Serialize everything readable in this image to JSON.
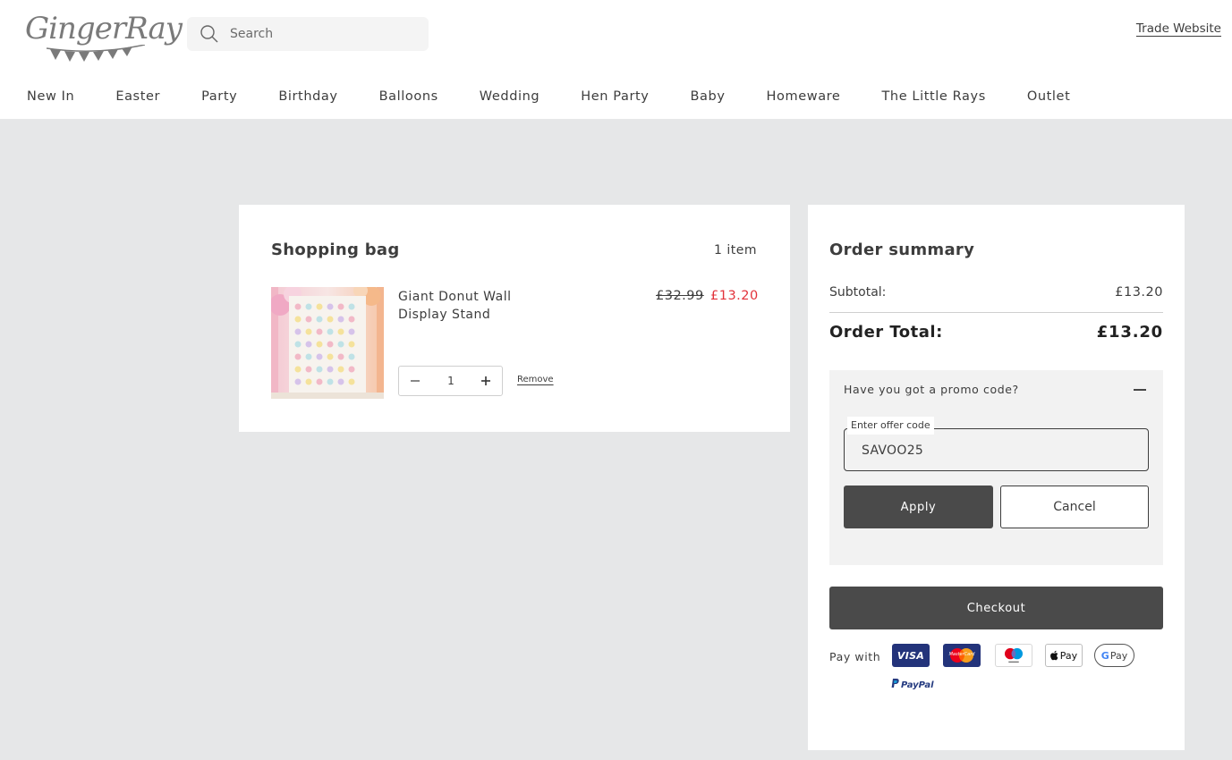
{
  "header": {
    "logo_text": "GingerRay",
    "search_placeholder": "Search",
    "trade_link": "Trade Website"
  },
  "nav": {
    "items": [
      "New In",
      "Easter",
      "Party",
      "Birthday",
      "Balloons",
      "Wedding",
      "Hen Party",
      "Baby",
      "Homeware",
      "The Little Rays",
      "Outlet"
    ]
  },
  "bag": {
    "title": "Shopping bag",
    "item_count": "1 item",
    "items": [
      {
        "name": "Giant Donut Wall Display Stand",
        "price_original": "£32.99",
        "price_sale": "£13.20",
        "quantity": "1",
        "remove_label": "Remove"
      }
    ]
  },
  "summary": {
    "title": "Order summary",
    "subtotal_label": "Subtotal:",
    "subtotal_value": "£13.20",
    "total_label": "Order Total:",
    "total_value": "£13.20",
    "promo": {
      "question": "Have you got a promo code?",
      "field_label": "Enter offer code",
      "field_value": "SAVOO25",
      "apply_label": "Apply",
      "cancel_label": "Cancel"
    },
    "checkout_label": "Checkout",
    "pay_with_label": "Pay with",
    "payment_methods": {
      "visa": "VISA",
      "mastercard": "MasterCard",
      "apple_pay": "Pay",
      "google_pay": "Pay",
      "google_g": "G",
      "paypal": "PayPal"
    }
  },
  "colors": {
    "page_bg": "#e6e7e8",
    "panel_bg": "#ffffff",
    "text": "#3d3d3d",
    "sale_price": "#e2333b",
    "button_dark": "#4a4a4a",
    "promo_bg": "#f2f2f2"
  }
}
